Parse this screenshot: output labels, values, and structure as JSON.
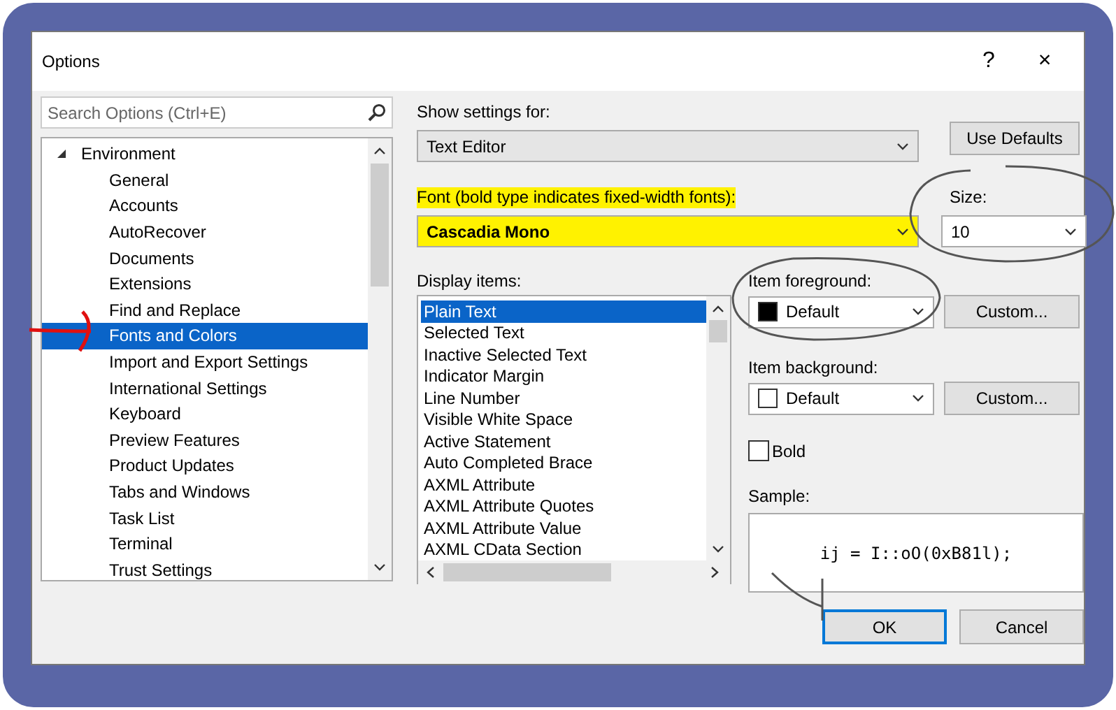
{
  "window": {
    "title": "Options",
    "help": "?",
    "close": "×"
  },
  "search": {
    "placeholder": "Search Options (Ctrl+E)"
  },
  "tree": [
    {
      "label": "Environment",
      "expanded": true,
      "selected": false,
      "children": [
        {
          "label": "General",
          "selected": false
        },
        {
          "label": "Accounts",
          "selected": false
        },
        {
          "label": "AutoRecover",
          "selected": false
        },
        {
          "label": "Documents",
          "selected": false
        },
        {
          "label": "Extensions",
          "selected": false
        },
        {
          "label": "Find and Replace",
          "selected": false
        },
        {
          "label": "Fonts and Colors",
          "selected": true
        },
        {
          "label": "Import and Export Settings",
          "selected": false
        },
        {
          "label": "International Settings",
          "selected": false
        },
        {
          "label": "Keyboard",
          "selected": false
        },
        {
          "label": "Preview Features",
          "selected": false
        },
        {
          "label": "Product Updates",
          "selected": false
        },
        {
          "label": "Tabs and Windows",
          "selected": false
        },
        {
          "label": "Task List",
          "selected": false
        },
        {
          "label": "Terminal",
          "selected": false
        },
        {
          "label": "Trust Settings",
          "selected": false
        }
      ]
    }
  ],
  "show_settings_for": {
    "label": "Show settings for:",
    "value": "Text Editor"
  },
  "use_defaults_button": "Use Defaults",
  "font": {
    "label": "Font (bold type indicates fixed-width fonts):",
    "value": "Cascadia Mono",
    "highlighted": true
  },
  "size": {
    "label": "Size:",
    "value": "10"
  },
  "display_items": {
    "label": "Display items:",
    "items": [
      {
        "label": "Plain Text",
        "selected": true
      },
      {
        "label": "Selected Text",
        "selected": false
      },
      {
        "label": "Inactive Selected Text",
        "selected": false
      },
      {
        "label": "Indicator Margin",
        "selected": false
      },
      {
        "label": "Line Number",
        "selected": false
      },
      {
        "label": "Visible White Space",
        "selected": false
      },
      {
        "label": "Active Statement",
        "selected": false
      },
      {
        "label": "Auto Completed Brace",
        "selected": false
      },
      {
        "label": "AXML Attribute",
        "selected": false
      },
      {
        "label": "AXML Attribute Quotes",
        "selected": false
      },
      {
        "label": "AXML Attribute Value",
        "selected": false
      },
      {
        "label": "AXML CData Section",
        "selected": false
      }
    ]
  },
  "item_foreground": {
    "label": "Item foreground:",
    "value": "Default",
    "color": "#000000",
    "button": "Custom..."
  },
  "item_background": {
    "label": "Item background:",
    "value": "Default",
    "color": "#ffffff",
    "button": "Custom..."
  },
  "bold": {
    "label": "Bold",
    "checked": false
  },
  "sample": {
    "label": "Sample:",
    "text": "ij = I::oO(0xB81l);"
  },
  "buttons": [
    {
      "label": "OK",
      "default": true
    },
    {
      "label": "Cancel",
      "default": false
    }
  ]
}
